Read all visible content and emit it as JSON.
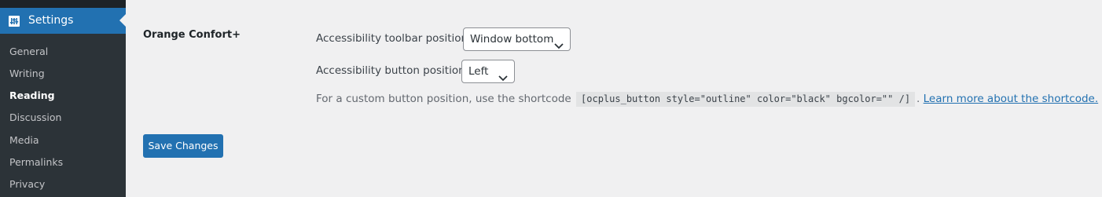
{
  "sidebar": {
    "current_menu": {
      "label": "Settings",
      "icon": "settings-sliders-icon"
    },
    "items": [
      {
        "label": "General"
      },
      {
        "label": "Writing"
      },
      {
        "label": "Reading",
        "current": true
      },
      {
        "label": "Discussion"
      },
      {
        "label": "Media"
      },
      {
        "label": "Permalinks"
      },
      {
        "label": "Privacy"
      }
    ]
  },
  "main": {
    "section_title": "Orange Confort+",
    "toolbar_position": {
      "label": "Accessibility toolbar position:",
      "value": "Window bottom"
    },
    "button_position": {
      "label": "Accessibility button position:",
      "value": "Left"
    },
    "help": {
      "prefix": "For a custom button position, use the shortcode",
      "shortcode": "[ocplus_button style=\"outline\" color=\"black\" bgcolor=\"\" /]",
      "separator": ".",
      "link_text": "Learn more about the shortcode."
    },
    "save_label": "Save Changes"
  },
  "colors": {
    "accent": "#2271b1",
    "sidebar_bg": "#1d2327",
    "submenu_bg": "#2c3338",
    "page_bg": "#f0f0f1"
  }
}
